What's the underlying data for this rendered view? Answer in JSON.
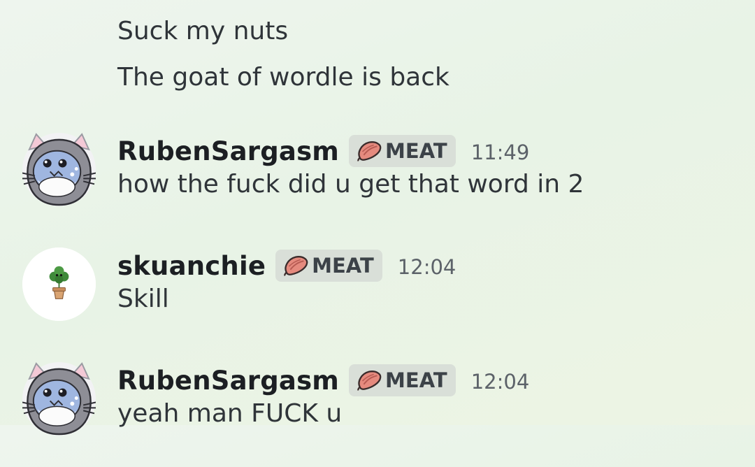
{
  "continuation_messages": [
    "Suck my nuts",
    "The goat of wordle is back"
  ],
  "messages": [
    {
      "author": "RubenSargasm",
      "avatar_icon": "shark-cat-hood-avatar",
      "role": "MEAT",
      "time": "11:49",
      "text": "how the fuck did u get that word in 2"
    },
    {
      "author": "skuanchie",
      "avatar_icon": "potted-plant-avatar",
      "role": "MEAT",
      "time": "12:04",
      "text": "Skill"
    },
    {
      "author": "RubenSargasm",
      "avatar_icon": "shark-cat-hood-avatar",
      "role": "MEAT",
      "time": "12:04",
      "text": "yeah man FUCK u"
    }
  ],
  "colors": {
    "role_tag_bg": "#d9dfd8",
    "meat_icon": "#e58a7e",
    "background": "#eaf4e8"
  }
}
